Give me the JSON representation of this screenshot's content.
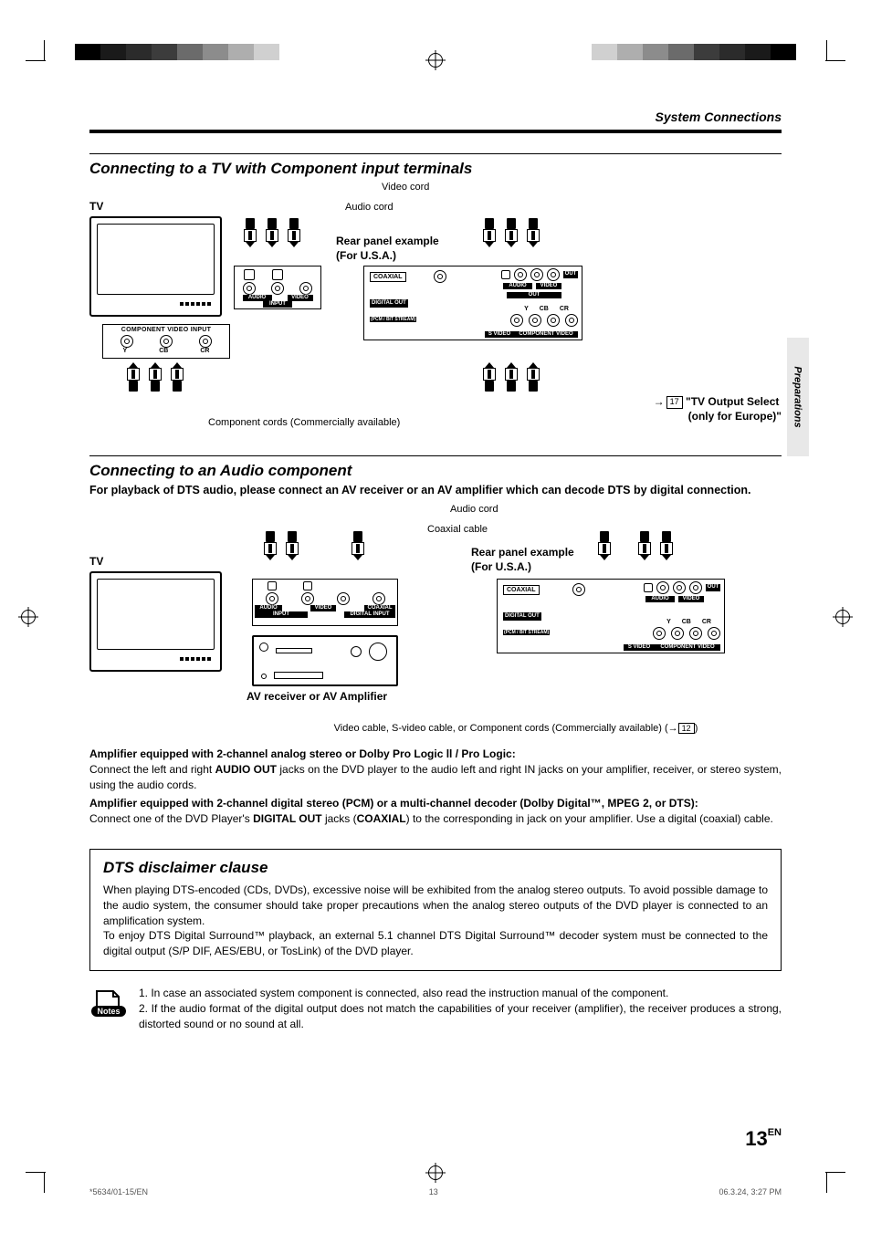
{
  "header": {
    "section": "System Connections"
  },
  "sidebar_tab": "Preparations",
  "sections": {
    "s1_title": "Connecting to a TV with Component input terminals",
    "s1": {
      "tv_label": "TV",
      "video_cord": "Video cord",
      "audio_cord": "Audio cord",
      "rear_panel_l1": "Rear panel example",
      "rear_panel_l2": "(For U.S.A.)",
      "comp_in_title": "COMPONENT VIDEO INPUT",
      "comp_in_y": "Y",
      "comp_in_cb": "CB",
      "comp_in_cr": "CR",
      "audio_input": "AUDIO",
      "video_input": "VIDEO",
      "input_text": "INPUT",
      "coaxial": "COAXIAL",
      "digital_out_l1": "DIGITAL OUT",
      "digital_out_l2": "(PCM / BIT STREAM)",
      "out_audio": "AUDIO",
      "out_video": "VIDEO",
      "out_text": "OUT",
      "svideo_out": "S VIDEO",
      "comp_video": "COMPONENT  VIDEO",
      "y": "Y",
      "cb": "CB",
      "cr": "CR",
      "component_cords": "Component cords  (Commercially available)",
      "tv_output_ref_page": "17",
      "tv_output_ref_l1": "\"TV Output Select",
      "tv_output_ref_l2": "(only for Europe)\""
    },
    "s2_title": "Connecting to an Audio component",
    "s2_lead": "For playback of DTS audio, please connect an AV receiver or an AV amplifier which can decode DTS by digital connection.",
    "s2": {
      "tv_label": "TV",
      "audio_cord": "Audio cord",
      "coaxial_cable": "Coaxial cable",
      "rear_panel_l1": "Rear panel example",
      "rear_panel_l2": "(For U.S.A.)",
      "av_amp_label": "AV receiver or AV Amplifier",
      "audio_input": "AUDIO",
      "video_input": "VIDEO",
      "input_text": "INPUT",
      "coax_in": "COAXIAL",
      "dig_in": "DIGITAL INPUT",
      "coaxial": "COAXIAL",
      "digital_out_l1": "DIGITAL OUT",
      "digital_out_l2": "(PCM / BIT STREAM)",
      "out_audio": "AUDIO",
      "out_video": "VIDEO",
      "out_text": "OUT",
      "svideo_out": "S VIDEO",
      "comp_video": "COMPONENT  VIDEO",
      "y": "Y",
      "cb": "CB",
      "cr": "CR",
      "video_cable_note": "Video cable, S-video cable, or Component cords (Commercially available) (→",
      "video_cable_ref": "12",
      "video_cable_note_close": ")"
    },
    "amp1_head": "Amplifier equipped with 2-channel analog stereo or Dolby Pro Logic ll / Pro Logic:",
    "amp1_body_a": "Connect the left and right ",
    "amp1_body_b": "AUDIO OUT",
    "amp1_body_c": " jacks on the DVD player to the audio left and right IN jacks on your amplifier, receiver, or stereo system, using the audio cords.",
    "amp2_head": "Amplifier equipped with 2-channel digital stereo (PCM) or a multi-channel decoder (Dolby Digital™, MPEG 2, or DTS):",
    "amp2_body_a": "Connect one of the DVD Player's ",
    "amp2_body_b": "DIGITAL OUT",
    "amp2_body_c": " jacks (",
    "amp2_body_d": "COAXIAL",
    "amp2_body_e": ") to the corresponding in jack on your amplifier. Use a digital (coaxial) cable."
  },
  "dts": {
    "title": "DTS disclaimer clause",
    "p1": "When playing DTS-encoded (CDs, DVDs), excessive noise will be exhibited from the analog stereo outputs. To avoid possible damage to the audio system, the consumer should take proper precautions when the analog stereo outputs of the DVD player is connected to an amplification system.",
    "p2": "To enjoy DTS Digital Surround™ playback, an external 5.1 channel DTS Digital Surround™ decoder system must be connected to the digital output (S/P DIF, AES/EBU, or TosLink) of the DVD player."
  },
  "notes": {
    "label": "Notes",
    "n1": "In case an associated system component is connected, also read the instruction manual of the component.",
    "n2": "If the audio format of the digital output does not match the capabilities of your receiver (amplifier), the receiver produces a strong, distorted sound or no sound at all."
  },
  "page_number": "13",
  "page_lang": "EN",
  "footer": {
    "doc_id": "*5634/01-15/EN",
    "page": "13",
    "timestamp": "06.3.24, 3:27 PM"
  }
}
